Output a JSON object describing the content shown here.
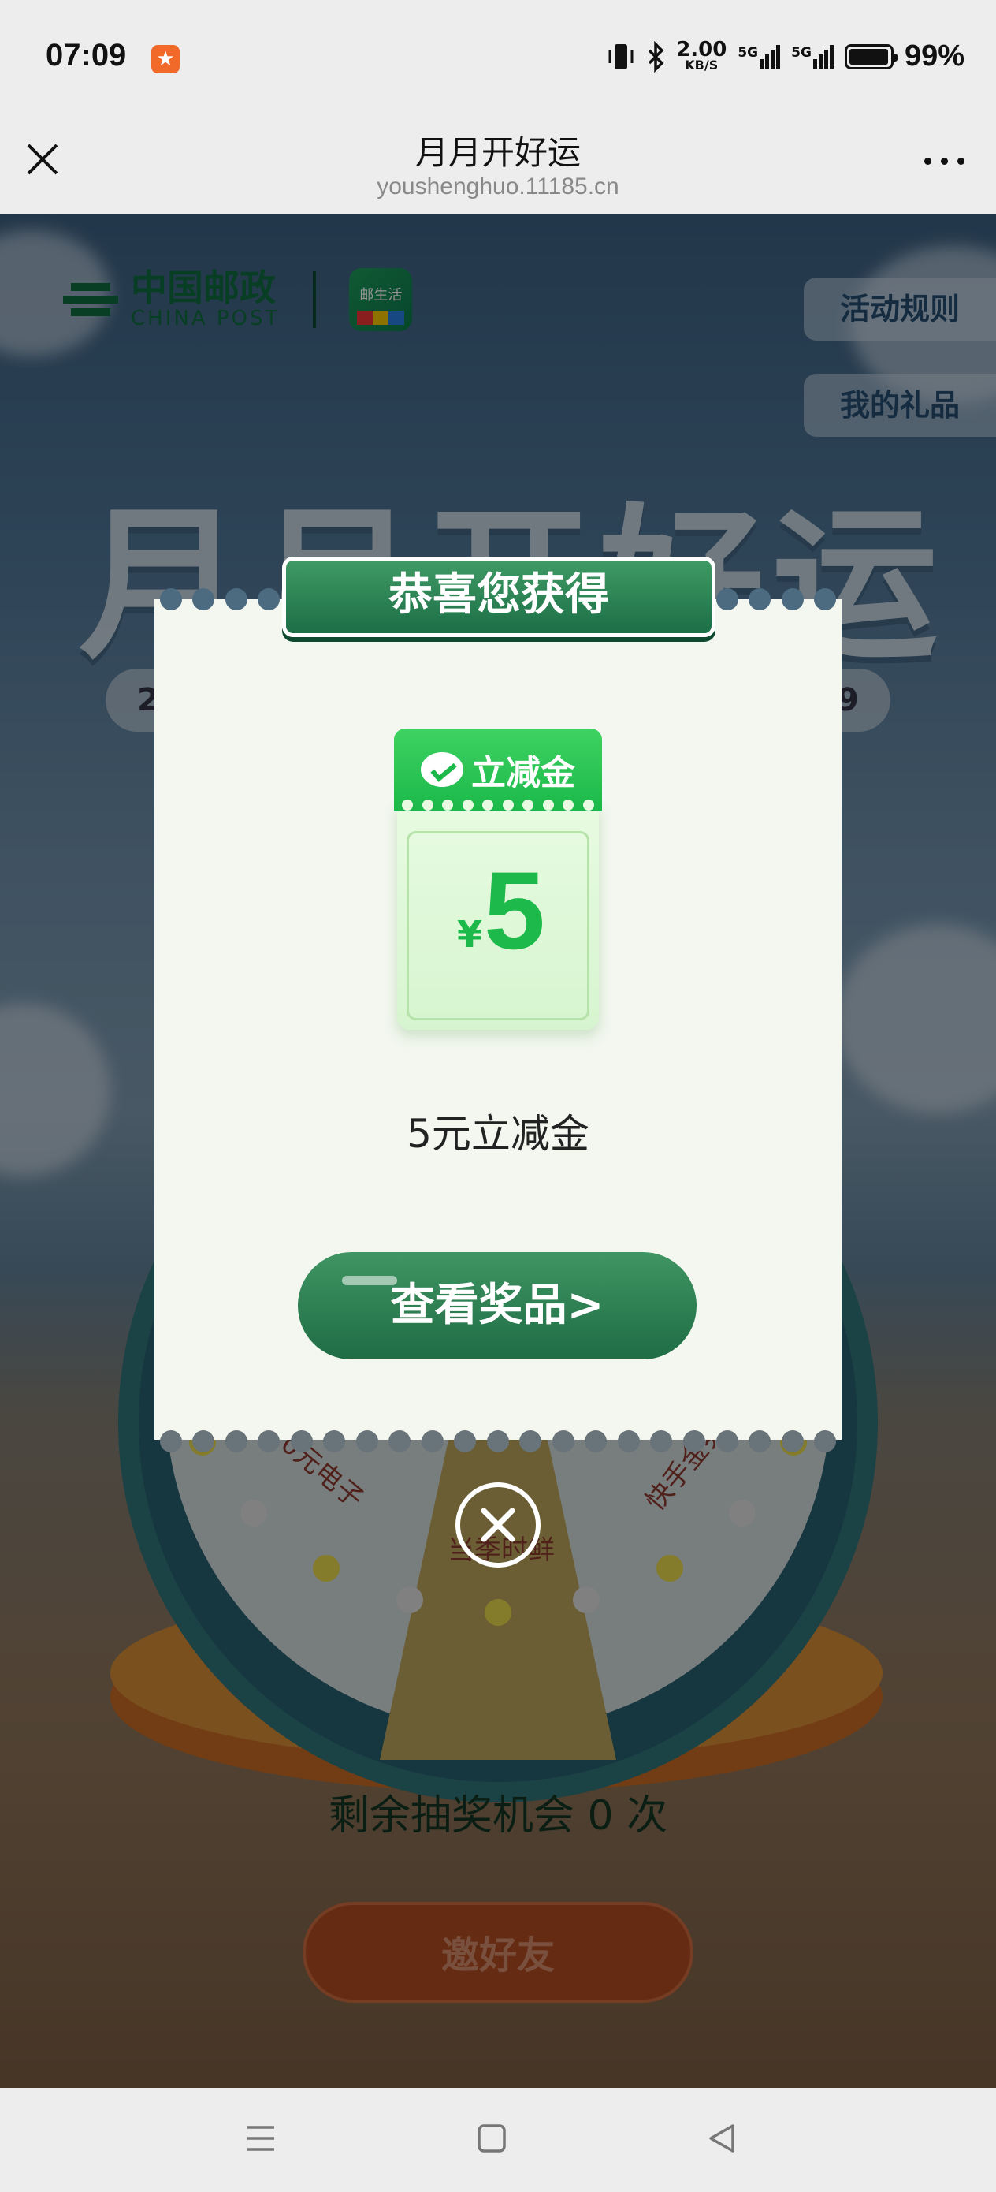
{
  "status_bar": {
    "time": "07:09",
    "app_icon": "taobao-style-app-icon",
    "net_speed_value": "2.00",
    "net_speed_unit": "KB/S",
    "signal1_label": "5G",
    "signal2_label": "5G",
    "battery_percent": "99%",
    "battery_level": 0.99
  },
  "nav": {
    "title": "月月开好运",
    "url": "youshenghuo.11185.cn"
  },
  "page": {
    "logo_cn": "中国邮政",
    "logo_en": "CHINA POST",
    "app_logo_text": "邮生活",
    "rules_button": "活动规则",
    "gifts_button": "我的礼品",
    "big_title": "月月开好运",
    "date_left": "2",
    "date_right": "9",
    "wheel_text_left": "10元电子",
    "wheel_text_bottom": "当季时鲜",
    "wheel_text_right": "快手金券",
    "remaining": "剩余抽奖机会 0 次",
    "invite_button": "邀好友"
  },
  "modal": {
    "banner": "恭喜您获得",
    "coupon_header": "立减金",
    "coupon_currency": "¥",
    "coupon_amount": "5",
    "prize_name": "5元立减金",
    "view_button": "查看奖品>"
  },
  "colors": {
    "modal_green": "#1c6e46",
    "coupon_green": "#1bb94a",
    "invite_orange": "#b04a22"
  }
}
